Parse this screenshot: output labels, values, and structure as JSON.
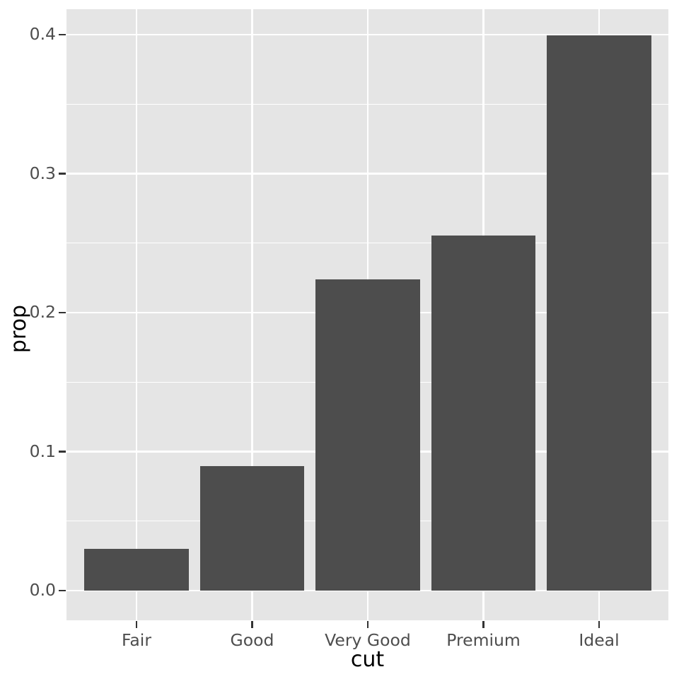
{
  "chart_data": {
    "type": "bar",
    "title": "",
    "subtitle": "",
    "xlabel": "cut",
    "ylabel": "prop",
    "categories": [
      "Fair",
      "Good",
      "Very Good",
      "Premium",
      "Ideal"
    ],
    "values": [
      0.0298,
      0.0896,
      0.224,
      0.2554,
      0.3995
    ],
    "series": [
      {
        "name": "prop",
        "values": [
          0.0298,
          0.0896,
          0.224,
          0.2554,
          0.3995
        ]
      }
    ],
    "ylim": [
      -0.0198,
      0.4198
    ],
    "xtick_labels": [
      "Fair",
      "Good",
      "Very Good",
      "Premium",
      "Ideal"
    ],
    "ytick_labels": [
      "0.0",
      "0.1",
      "0.2",
      "0.3",
      "0.4"
    ],
    "ytick_values": [
      0.0,
      0.1,
      0.2,
      0.3,
      0.4
    ],
    "yminor_values": [
      0.05,
      0.15,
      0.25,
      0.35
    ],
    "grid": "horizontal-major-minor-and-vertical-major",
    "legend": "none",
    "legend_position": "none",
    "bar_color": "#4d4d4d",
    "panel_background": "#e5e5e5",
    "grid_color": "#ffffff",
    "plot_background": "#ffffff",
    "axis_text_color": "#4d4d4d",
    "axis_title_color": "#000000",
    "theme": "ggplot2-grey"
  }
}
